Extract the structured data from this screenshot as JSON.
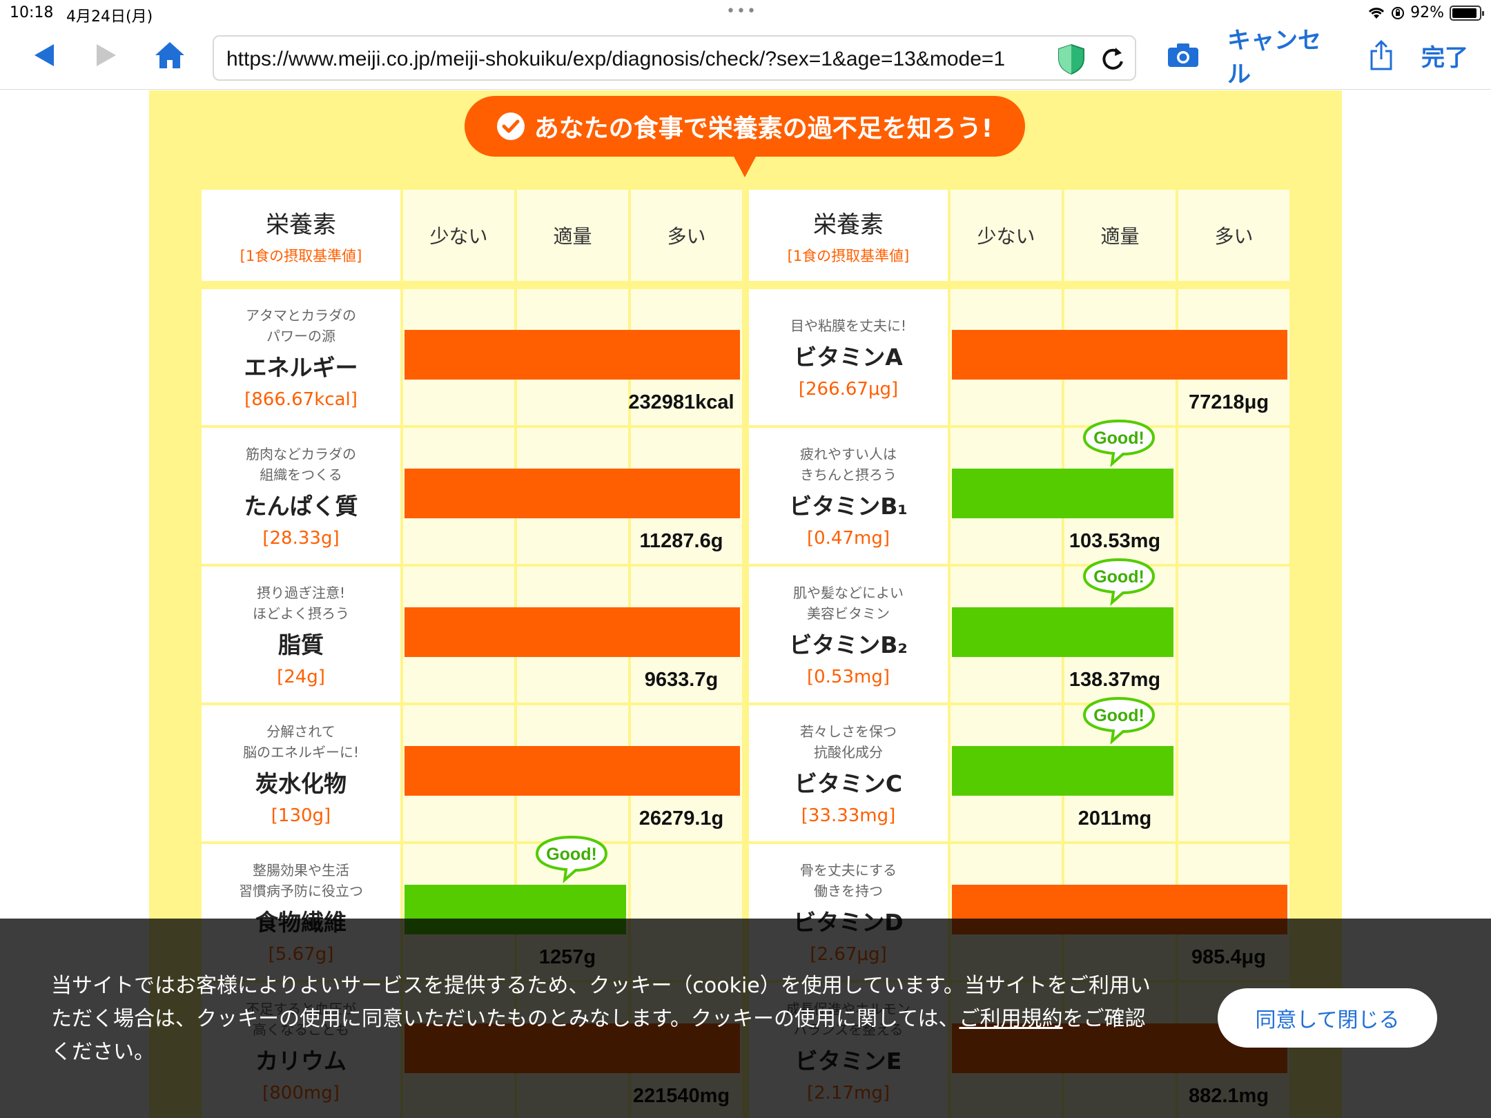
{
  "status_bar": {
    "time": "10:18",
    "date": "4月24日(月)",
    "dots": "•••",
    "battery": "92%",
    "battery_level": 0.92
  },
  "browser": {
    "url": "https://www.meiji.co.jp/meiji-shokuiku/exp/diagnosis/check/?sex=1&age=13&mode=1",
    "cancel_label": "キャンセル",
    "done_label": "完了"
  },
  "banner": {
    "text": "あなたの食事で栄養素の過不足を知ろう!"
  },
  "table_header": {
    "nutrient": "栄養素",
    "standard": "[1食の摂取基準値]",
    "levels": [
      "少ない",
      "適量",
      "多い"
    ]
  },
  "good_label": "Good!",
  "colors": {
    "over": "#ff5f00",
    "good": "#54cc00",
    "panel": "#fff58a",
    "cell": "#fffde0"
  },
  "nutrients": [
    {
      "desc": [
        "アタマとカラダの",
        "パワーの源"
      ],
      "name": "エネルギー",
      "standard": "[866.67kcal]",
      "amount": "232981kcal",
      "level": "多い",
      "fill": 3.0,
      "good": false
    },
    {
      "desc": [
        "目や粘膜を丈夫に!"
      ],
      "name": "ビタミンA",
      "standard": "[266.67μg]",
      "amount": "77218μg",
      "level": "多い",
      "fill": 3.0,
      "good": false
    },
    {
      "desc": [
        "筋肉などカラダの",
        "組織をつくる"
      ],
      "name": "たんぱく質",
      "standard": "[28.33g]",
      "amount": "11287.6g",
      "level": "多い",
      "fill": 3.0,
      "good": false
    },
    {
      "desc": [
        "疲れやすい人は",
        "きちんと摂ろう"
      ],
      "name": "ビタミンB₁",
      "standard": "[0.47mg]",
      "amount": "103.53mg",
      "level": "適量",
      "fill": 2.0,
      "good": true
    },
    {
      "desc": [
        "摂り過ぎ注意!",
        "ほどよく摂ろう"
      ],
      "name": "脂質",
      "standard": "[24g]",
      "amount": "9633.7g",
      "level": "多い",
      "fill": 3.0,
      "good": false
    },
    {
      "desc": [
        "肌や髪などによい",
        "美容ビタミン"
      ],
      "name": "ビタミンB₂",
      "standard": "[0.53mg]",
      "amount": "138.37mg",
      "level": "適量",
      "fill": 2.0,
      "good": true
    },
    {
      "desc": [
        "分解されて",
        "脳のエネルギーに!"
      ],
      "name": "炭水化物",
      "standard": "[130g]",
      "amount": "26279.1g",
      "level": "多い",
      "fill": 3.0,
      "good": false
    },
    {
      "desc": [
        "若々しさを保つ",
        "抗酸化成分"
      ],
      "name": "ビタミンC",
      "standard": "[33.33mg]",
      "amount": "2011mg",
      "level": "適量",
      "fill": 2.0,
      "good": true
    },
    {
      "desc": [
        "整腸効果や生活",
        "習慣病予防に役立つ"
      ],
      "name": "食物繊維",
      "standard": "[5.67g]",
      "amount": "1257g",
      "level": "適量",
      "fill": 2.0,
      "good": true
    },
    {
      "desc": [
        "骨を丈夫にする",
        "働きを持つ"
      ],
      "name": "ビタミンD",
      "standard": "[2.67μg]",
      "amount": "985.4μg",
      "level": "多い",
      "fill": 3.0,
      "good": false
    },
    {
      "desc": [
        "不足すると血圧が",
        "高くなることも"
      ],
      "name": "カリウム",
      "standard": "[800mg]",
      "amount": "221540mg",
      "level": "多い",
      "fill": 3.0,
      "good": false
    },
    {
      "desc": [
        "成長促進やホルモン",
        "バランスを整える"
      ],
      "name": "ビタミンE",
      "standard": "[2.17mg]",
      "amount": "882.1mg",
      "level": "多い",
      "fill": 3.0,
      "good": false
    }
  ],
  "cookie": {
    "text_before": "当サイトではお客様によりよいサービスを提供するため、クッキー（cookie）を使用しています。当サイトをご利用いただく場合は、クッキーの使用に同意いただいたものとみなします。クッキーの使用に関しては、",
    "link": "ご利用規約",
    "text_after": "をご確認ください。",
    "button": "同意して閉じる"
  }
}
